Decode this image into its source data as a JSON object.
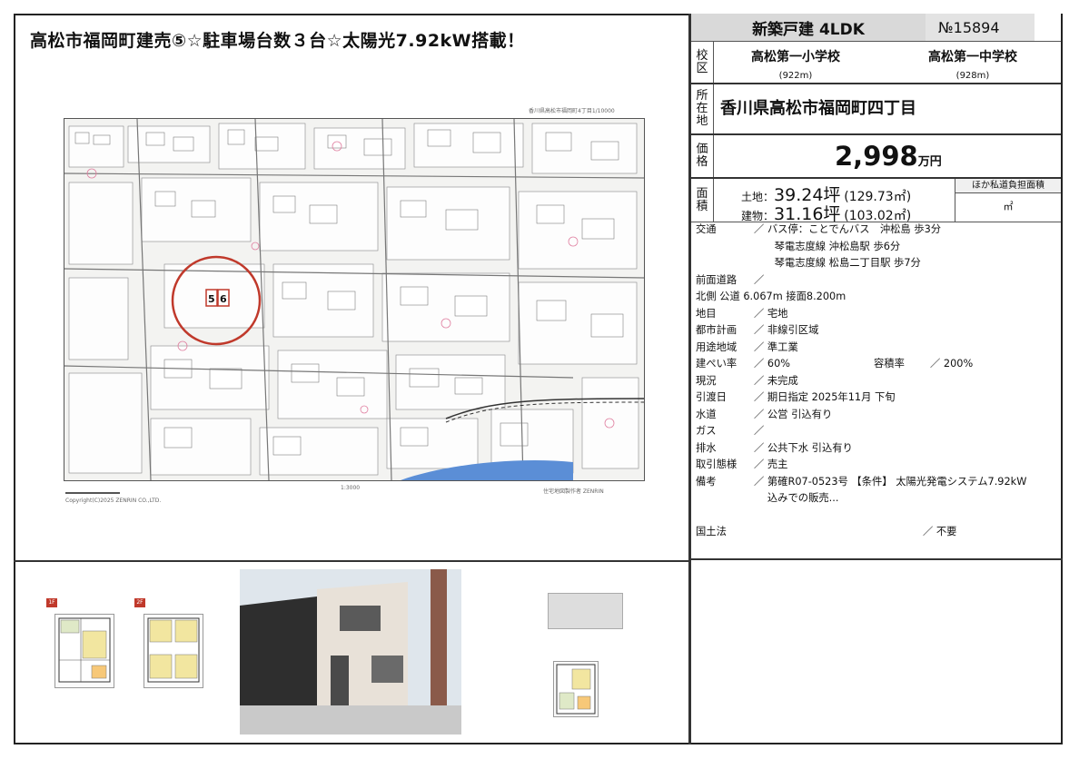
{
  "headline": "高松市福岡町建売⑤☆駐車場台数３台☆太陽光7.92kW搭載！",
  "map": {
    "caption_top_right": "香川県高松市福岡町4丁目1/10000",
    "scale_label": "1:3000",
    "copyright": "Copyright(C)2025 ZENRIN CO.,LTD.",
    "publisher": "住宅地図製作者 ZENRIN",
    "lot_numbers": [
      "5",
      "6"
    ]
  },
  "panel": {
    "type_label": "新築戸建 4LDK",
    "number_label": "№15894",
    "school_label": [
      "校",
      "区"
    ],
    "elementary_name": "高松第一小学校",
    "elementary_dist": "(922m)",
    "junior_name": "高松第一中学校",
    "junior_dist": "(928m)",
    "address_label": [
      "所",
      "在",
      "地"
    ],
    "address": "香川県高松市福岡町四丁目",
    "price_label": [
      "価",
      "格"
    ],
    "price_value": "2,998",
    "price_unit": "万円",
    "area_label": [
      "面",
      "積"
    ],
    "land_prefix": "土地：",
    "land_tsubo": "39.24坪",
    "land_m2": "(129.73㎡)",
    "bldg_prefix": "建物：",
    "bldg_tsubo": "31.16坪",
    "bldg_m2": "(103.02㎡)",
    "extra_header": "ほか私道負担面積",
    "extra_value": "㎡"
  },
  "details": [
    {
      "k": "交通",
      "v": "／ バス停：ことでんバス　沖松島 歩3分"
    },
    {
      "k": "",
      "v": "　　琴電志度線 沖松島駅 歩6分"
    },
    {
      "k": "",
      "v": "　　琴電志度線 松島二丁目駅 歩7分"
    },
    {
      "k": "前面道路",
      "v": "／"
    },
    {
      "k": "北側 公道 6.067m 接面8.200m",
      "v": ""
    },
    {
      "k": "地目",
      "v": "／ 宅地"
    },
    {
      "k": "都市計画",
      "v": "／ 非線引区域"
    },
    {
      "k": "用途地域",
      "v": "／ 準工業"
    },
    {
      "k": "建ぺい率",
      "v": "／ 60%",
      "k2": "容積率",
      "v2": "／ 200%"
    },
    {
      "k": "現況",
      "v": "／ 未完成"
    },
    {
      "k": "引渡日",
      "v": "／ 期日指定 2025年11月 下旬"
    },
    {
      "k": "水道",
      "v": "／ 公営 引込有り"
    },
    {
      "k": "ガス",
      "v": "／"
    },
    {
      "k": "排水",
      "v": "／ 公共下水 引込有り"
    },
    {
      "k": "取引態様",
      "v": "／ 売主"
    },
    {
      "k": "備考",
      "v": "／ 第確R07-0523号 【条件】 太陽光発電システム7.92kW"
    },
    {
      "k": "",
      "v": "　 込みでの販売..."
    },
    {
      "k": "",
      "v": ""
    },
    {
      "k": "国土法",
      "v": "",
      "k2": "",
      "v2": "／ 不要"
    }
  ],
  "floorplans": {
    "tag_1f": "1F",
    "tag_2f": "2F"
  },
  "colors": {
    "accent_red": "#c0392b",
    "header_gray": "#d9d9d9"
  }
}
